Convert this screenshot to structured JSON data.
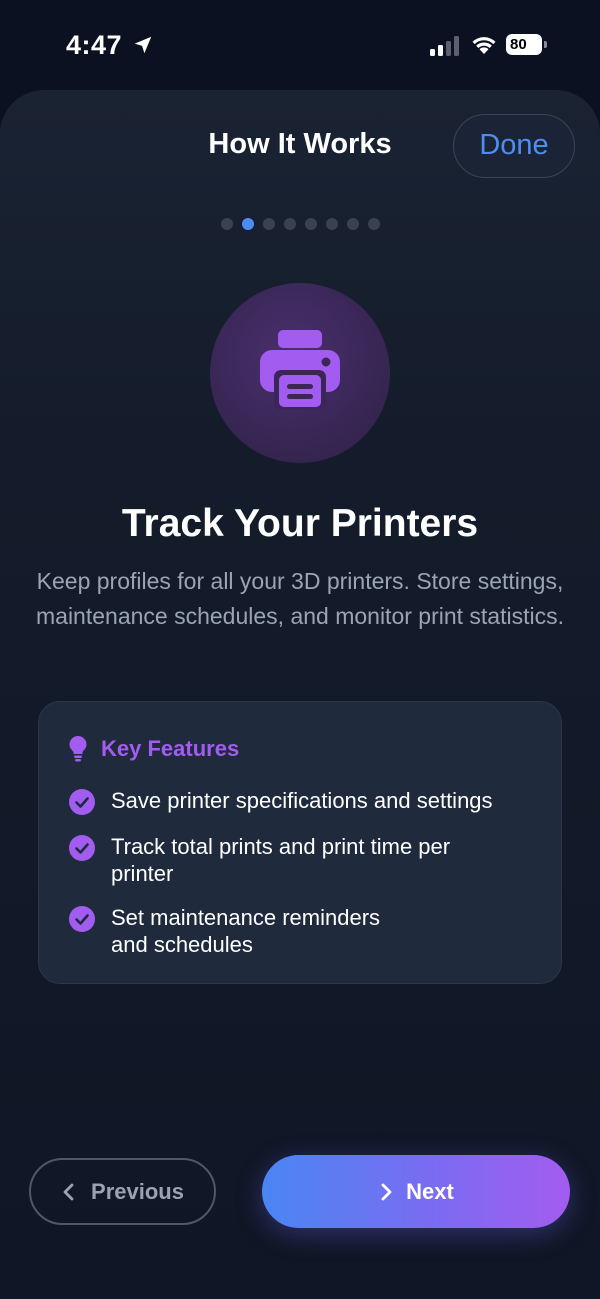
{
  "status_bar": {
    "time": "4:47",
    "battery_level": "80",
    "location_icon": "location-arrow-icon",
    "signal_icon": "cellular-signal-icon",
    "wifi_icon": "wifi-icon"
  },
  "header": {
    "title": "How It Works",
    "done_label": "Done"
  },
  "pager": {
    "total_pages": 8,
    "current_page": 2
  },
  "feature": {
    "icon": "printer-icon",
    "title": "Track Your Printers",
    "description": "Keep profiles for all your 3D printers. Store settings, maintenance schedules, and monitor print statistics."
  },
  "key_features": {
    "heading": "Key Features",
    "heading_icon": "lightbulb-icon",
    "items": [
      {
        "text": "Save printer specifications and settings",
        "icon": "check-circle-icon"
      },
      {
        "text": "Track total prints and print time per printer",
        "icon": "check-circle-icon"
      },
      {
        "text": "Set maintenance reminders and schedules",
        "icon": "check-circle-icon"
      }
    ]
  },
  "navigation": {
    "previous_label": "Previous",
    "next_label": "Next"
  },
  "colors": {
    "accent_blue": "#4d8df5",
    "accent_purple": "#a35cf0",
    "background": "#0b1120"
  }
}
